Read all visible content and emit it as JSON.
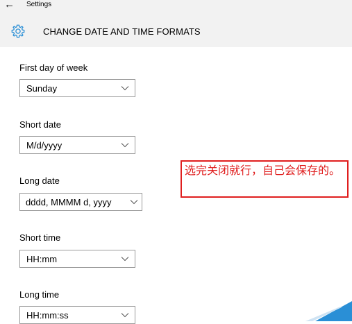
{
  "app_title": "Settings",
  "page_title": "CHANGE DATE AND TIME FORMATS",
  "fields": [
    {
      "label": "First day of week",
      "value": "Sunday"
    },
    {
      "label": "Short date",
      "value": "M/d/yyyy"
    },
    {
      "label": "Long date",
      "value": "dddd, MMMM d, yyyy"
    },
    {
      "label": "Short time",
      "value": "HH:mm"
    },
    {
      "label": "Long time",
      "value": "HH:mm:ss"
    }
  ],
  "annotation": "选完关闭就行，自己会保存的。",
  "colors": {
    "topbar_bg": "#f2f2f2",
    "accent": "#2a8fd6",
    "annotation": "#e01e1e"
  },
  "icons": {
    "back": "back-arrow-icon",
    "settings": "gear-icon",
    "dropdown": "chevron-down-icon"
  }
}
